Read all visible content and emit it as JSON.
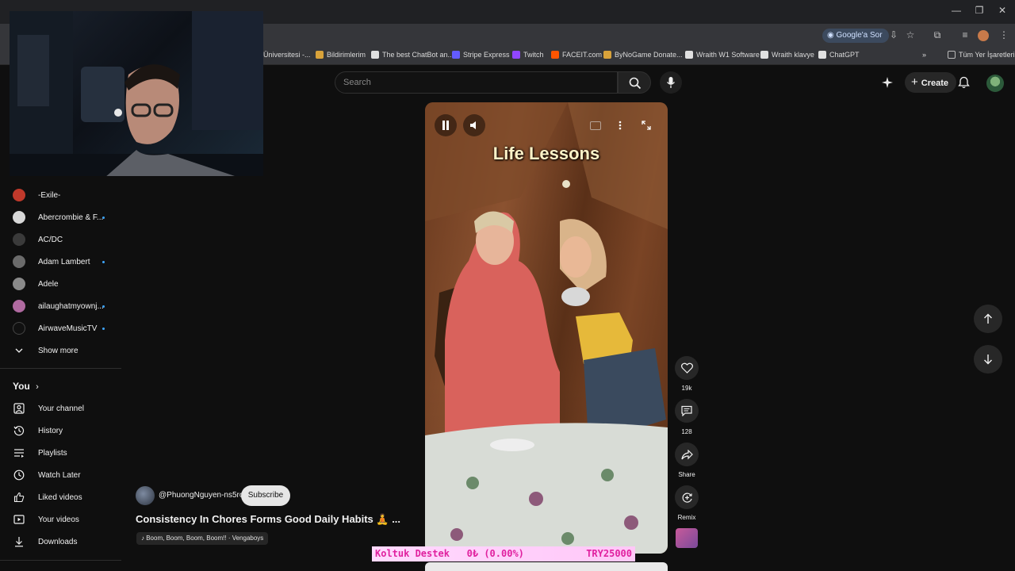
{
  "browser": {
    "ask_google": "Google'a Sor",
    "bookmarks": [
      "Üniversitesi -...",
      "Bildirimlerim",
      "The best ChatBot an...",
      "Stripe Express",
      "Twitch",
      "FACEIT.com",
      "ByNoGame Donate...",
      "Wraith W1 Software",
      "Wraith klavye",
      "ChatGPT"
    ],
    "all_bookmarks": "Tüm Yer İşaretleri"
  },
  "header": {
    "search_placeholder": "Search",
    "create_label": "Create"
  },
  "sidebar": {
    "subscriptions": [
      {
        "label": "-Exile-",
        "new": false,
        "color": "#c0392b"
      },
      {
        "label": "Abercrombie & F...",
        "new": true,
        "color": "#d8d8d8"
      },
      {
        "label": "AC/DC",
        "new": false,
        "color": "#444"
      },
      {
        "label": "Adam Lambert",
        "new": true,
        "color": "#6b6b6b"
      },
      {
        "label": "Adele",
        "new": false,
        "color": "#8a8a8a"
      },
      {
        "label": "ailaughatmyownj...",
        "new": true,
        "color": "#b06aa0"
      },
      {
        "label": "AirwaveMusicTV",
        "new": true,
        "color": "#222"
      }
    ],
    "show_more": "Show more",
    "you_label": "You",
    "you_items": [
      {
        "label": "Your channel",
        "icon": "person-icon"
      },
      {
        "label": "History",
        "icon": "history-icon"
      },
      {
        "label": "Playlists",
        "icon": "playlist-icon"
      },
      {
        "label": "Watch Later",
        "icon": "clock-icon"
      },
      {
        "label": "Liked videos",
        "icon": "thumbs-up-icon"
      },
      {
        "label": "Your videos",
        "icon": "video-icon"
      },
      {
        "label": "Downloads",
        "icon": "download-icon"
      }
    ]
  },
  "short": {
    "overlay_title": "Life Lessons",
    "channel": "@PhuongNguyen-ns5ro",
    "subscribe_label": "Subscribe",
    "title": "Consistency In Chores Forms Good Daily Habits 🧘 ...",
    "music": "♪ Boom, Boom, Boom, Boom!! · Vengaboys",
    "likes": "19k",
    "comments": "128",
    "share_label": "Share",
    "remix_label": "Remix"
  },
  "donation": {
    "label": "Koltuk Destek",
    "amount": "0₺ (0.00%)",
    "goal": "TRY25000"
  }
}
